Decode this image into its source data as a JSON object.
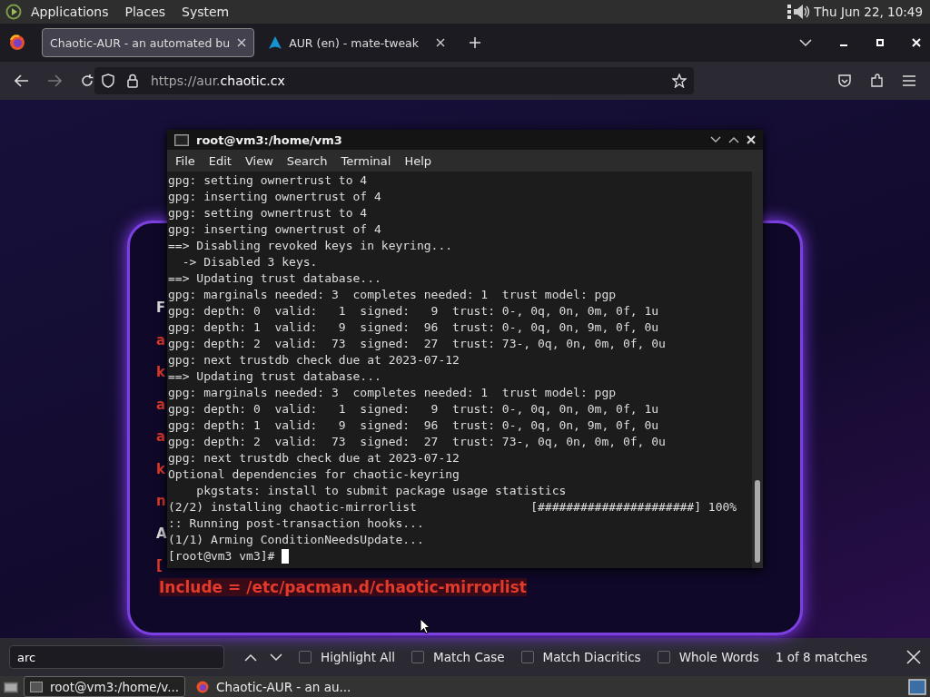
{
  "top_panel": {
    "menus": [
      "Applications",
      "Places",
      "System"
    ],
    "clock": "Thu Jun 22, 10:49"
  },
  "browser": {
    "tabs": [
      {
        "title": "Chaotic-AUR - an automated bu",
        "selected": true
      },
      {
        "title": "AUR (en) - mate-tweak",
        "selected": false
      }
    ],
    "url_prefix": "https://aur.",
    "url_domain": "chaotic.cx"
  },
  "page": {
    "fragments": [
      {
        "text": "F",
        "kind": "plain"
      },
      {
        "text": "a",
        "kind": "code"
      },
      {
        "text": "k",
        "kind": "code"
      },
      {
        "text": "a",
        "kind": "code"
      },
      {
        "text": "a",
        "kind": "code"
      },
      {
        "text": "k",
        "kind": "code"
      },
      {
        "text": "n",
        "kind": "code"
      },
      {
        "text": "A",
        "kind": "plain"
      },
      {
        "text": "[",
        "kind": "code"
      }
    ],
    "include_line": "Include = /etc/pacman.d/chaotic-mirrorlist"
  },
  "terminal": {
    "title": "root@vm3:/home/vm3",
    "menus": [
      "File",
      "Edit",
      "View",
      "Search",
      "Terminal",
      "Help"
    ],
    "lines": [
      "gpg: setting ownertrust to 4",
      "gpg: inserting ownertrust of 4",
      "gpg: setting ownertrust to 4",
      "gpg: inserting ownertrust of 4",
      "==> Disabling revoked keys in keyring...",
      "  -> Disabled 3 keys.",
      "==> Updating trust database...",
      "gpg: marginals needed: 3  completes needed: 1  trust model: pgp",
      "gpg: depth: 0  valid:   1  signed:   9  trust: 0-, 0q, 0n, 0m, 0f, 1u",
      "gpg: depth: 1  valid:   9  signed:  96  trust: 0-, 0q, 0n, 9m, 0f, 0u",
      "gpg: depth: 2  valid:  73  signed:  27  trust: 73-, 0q, 0n, 0m, 0f, 0u",
      "gpg: next trustdb check due at 2023-07-12",
      "==> Updating trust database...",
      "gpg: marginals needed: 3  completes needed: 1  trust model: pgp",
      "gpg: depth: 0  valid:   1  signed:   9  trust: 0-, 0q, 0n, 0m, 0f, 1u",
      "gpg: depth: 1  valid:   9  signed:  96  trust: 0-, 0q, 0n, 9m, 0f, 0u",
      "gpg: depth: 2  valid:  73  signed:  27  trust: 73-, 0q, 0n, 0m, 0f, 0u",
      "gpg: next trustdb check due at 2023-07-12",
      "Optional dependencies for chaotic-keyring",
      "    pkgstats: install to submit package usage statistics",
      "(2/2) installing chaotic-mirrorlist                [######################] 100%",
      ":: Running post-transaction hooks...",
      "(1/1) Arming ConditionNeedsUpdate..."
    ],
    "prompt": "[root@vm3 vm3]# "
  },
  "find_bar": {
    "value": "arc",
    "options": [
      {
        "label": "Highlight All",
        "checked": false
      },
      {
        "label": "Match Case",
        "checked": false
      },
      {
        "label": "Match Diacritics",
        "checked": false
      },
      {
        "label": "Whole Words",
        "checked": false
      }
    ],
    "result": "1 of 8 matches"
  },
  "taskbar": {
    "items": [
      "root@vm3:/home/v...",
      "Chaotic-AUR - an au..."
    ]
  }
}
